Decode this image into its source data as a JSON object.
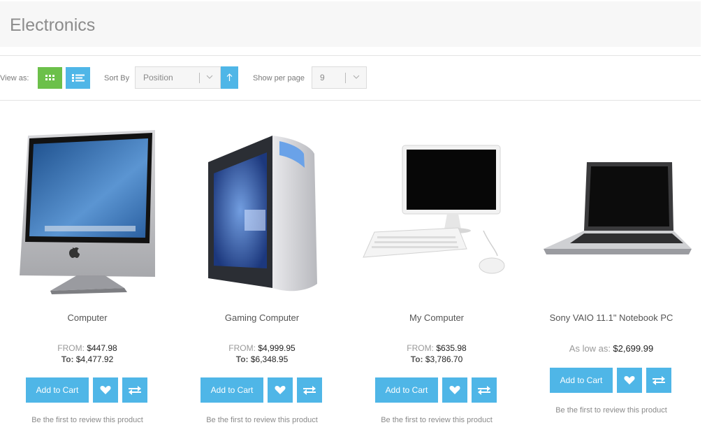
{
  "page": {
    "title": "Electronics"
  },
  "toolbar": {
    "view_as_label": "View as:",
    "sort_by_label": "Sort By",
    "sort_value": "Position",
    "show_per_page_label": "Show per page",
    "per_page_value": "9"
  },
  "colors": {
    "accent": "#4fb6e7",
    "grid_active": "#6cc04a"
  },
  "products": [
    {
      "name": "Computer",
      "price_from_label": "FROM:",
      "price_from": "$447.98",
      "price_to_label": "To:",
      "price_to": "$4,477.92",
      "add_to_cart": "Add to Cart",
      "review": "Be the first to review this product"
    },
    {
      "name": "Gaming Computer",
      "price_from_label": "FROM:",
      "price_from": "$4,999.95",
      "price_to_label": "To:",
      "price_to": "$6,348.95",
      "add_to_cart": "Add to Cart",
      "review": "Be the first to review this product"
    },
    {
      "name": "My Computer",
      "price_from_label": "FROM:",
      "price_from": "$635.98",
      "price_to_label": "To:",
      "price_to": "$3,786.70",
      "add_to_cart": "Add to Cart",
      "review": "Be the first to review this product"
    },
    {
      "name": "Sony VAIO 11.1\" Notebook PC",
      "as_low_as_label": "As low as:",
      "as_low_as": "$2,699.99",
      "add_to_cart": "Add to Cart",
      "review": "Be the first to review this product"
    }
  ],
  "icons": {
    "grid_view": "grid-icon",
    "list_view": "list-icon",
    "sort_direction": "arrow-up-icon",
    "chevron": "chevron-down-icon",
    "wishlist": "heart-icon",
    "compare": "compare-arrows-icon"
  }
}
